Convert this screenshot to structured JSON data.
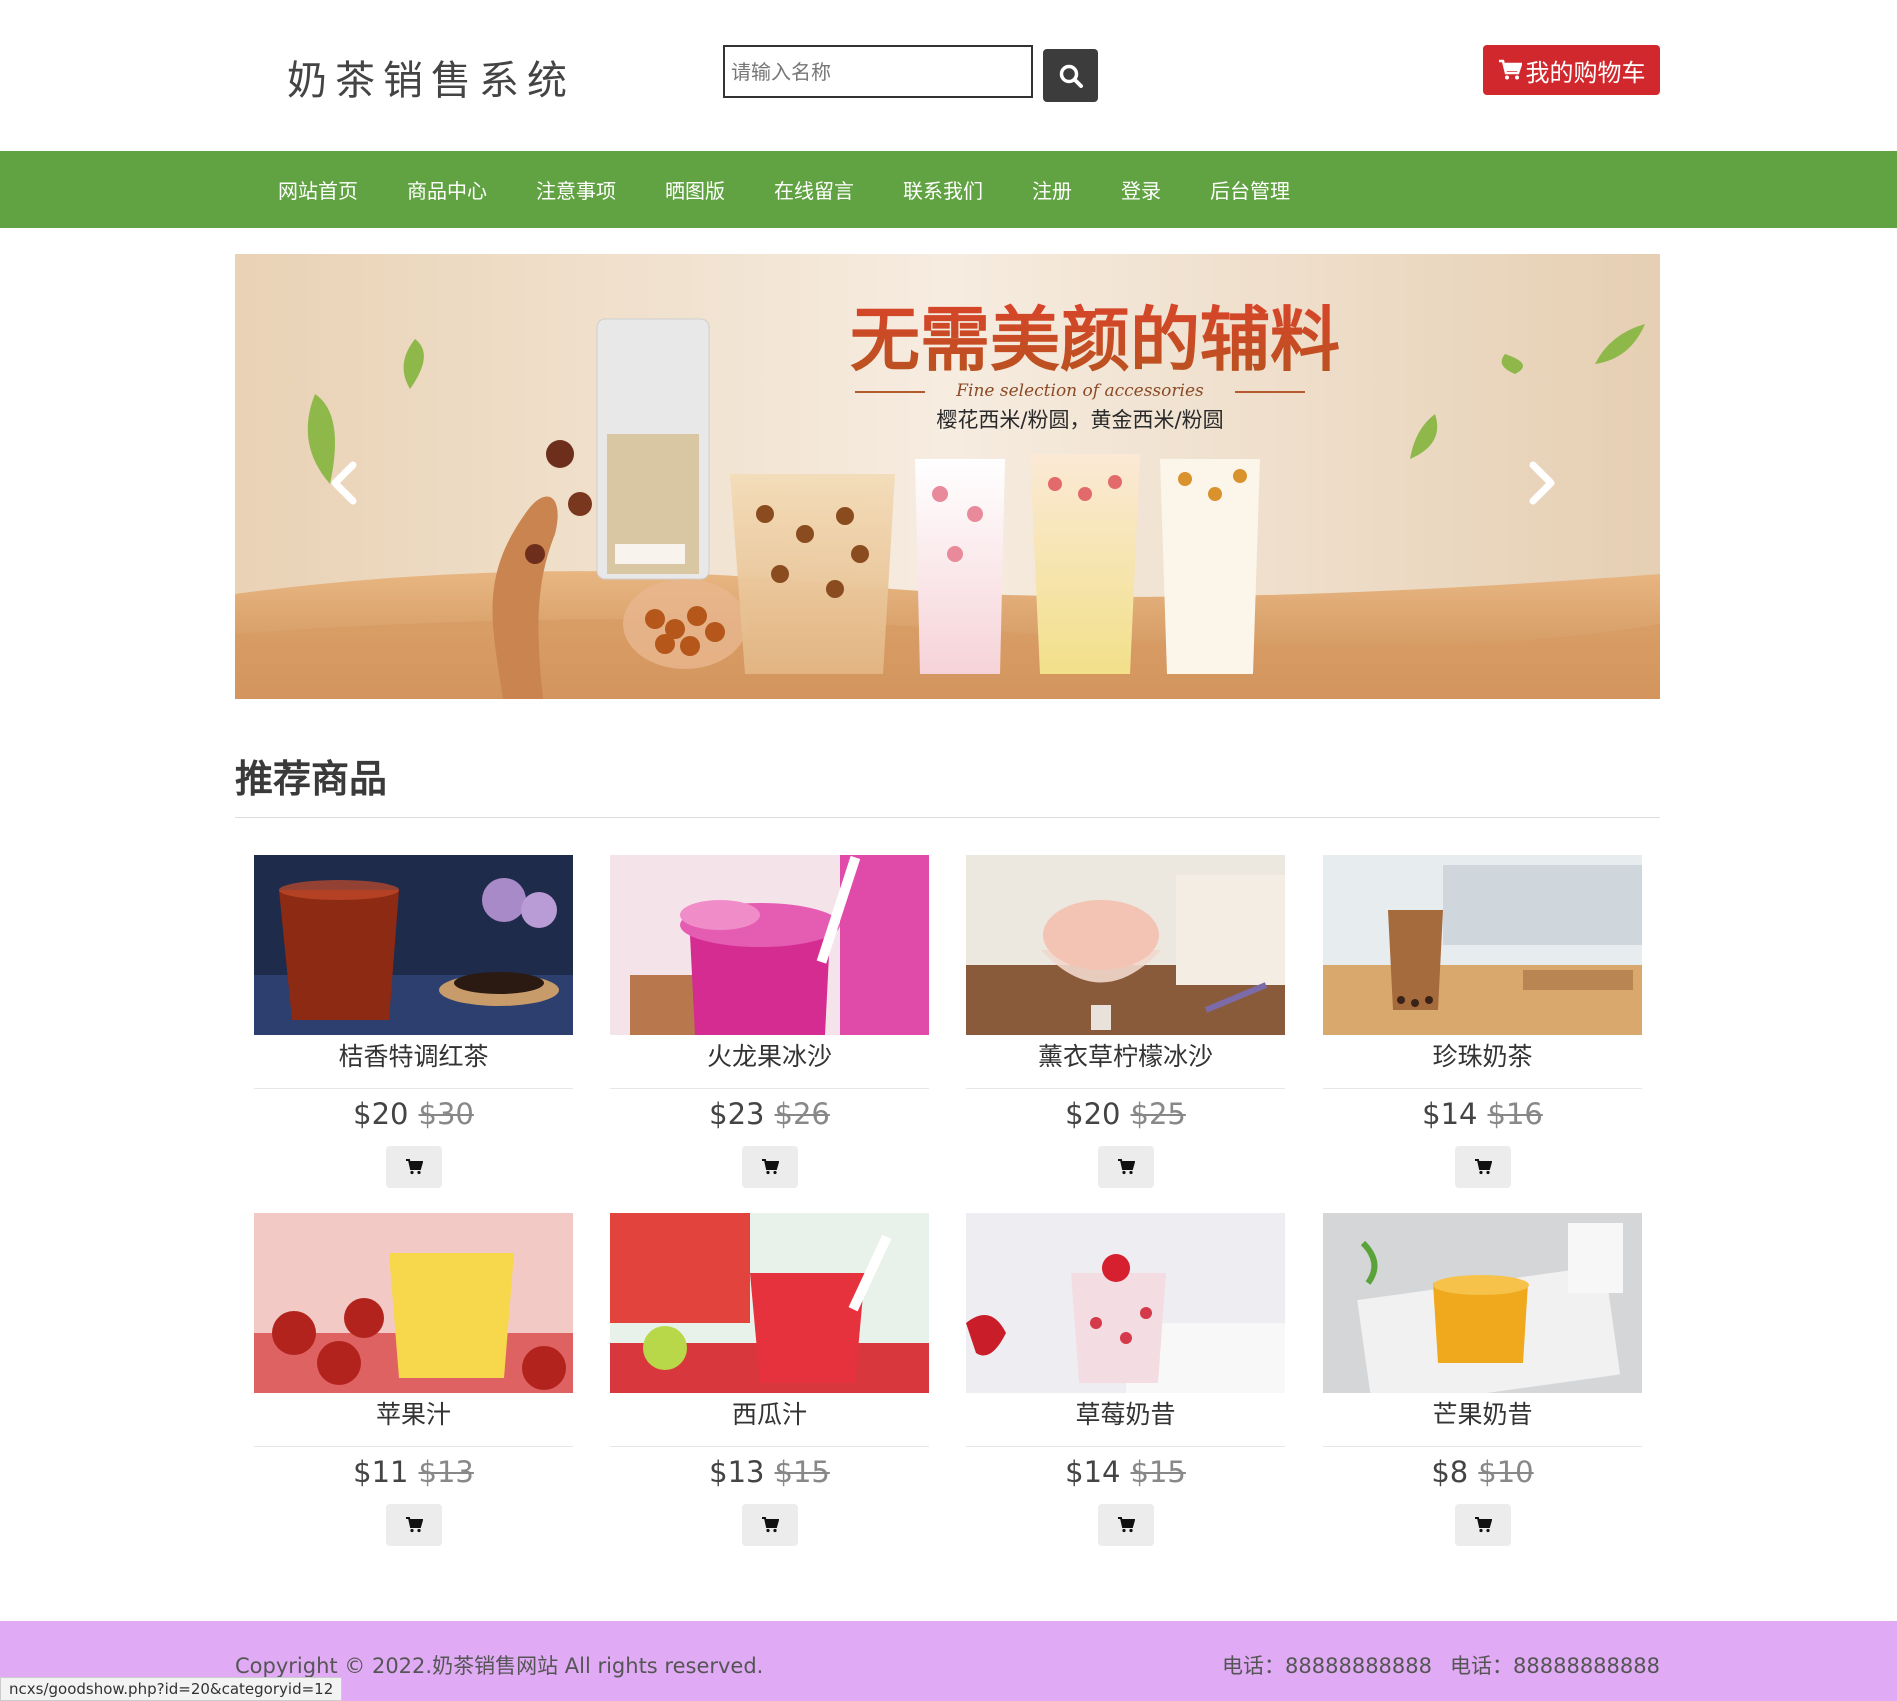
{
  "header": {
    "title": "奶茶销售系统",
    "search_placeholder": "请输入名称",
    "cart_label": "我的购物车"
  },
  "nav": {
    "items": [
      "网站首页",
      "商品中心",
      "注意事项",
      "晒图版",
      "在线留言",
      "联系我们",
      "注册",
      "登录",
      "后台管理"
    ]
  },
  "banner": {
    "headline": "无需美颜的辅料",
    "tagline": "Fine selection of accessories",
    "sub": "樱花西米/粉圆，黄金西米/粉圆"
  },
  "section": {
    "title": "推荐商品"
  },
  "products": [
    {
      "name": "桔香特调红茶",
      "price": "$20",
      "old_price": "$30",
      "image": "red-tea-photo"
    },
    {
      "name": "火龙果冰沙",
      "price": "$23",
      "old_price": "$26",
      "image": "dragonfruit-smoothie-photo"
    },
    {
      "name": "薰衣草柠檬冰沙",
      "price": "$20",
      "old_price": "$25",
      "image": "lavender-lemon-photo"
    },
    {
      "name": "珍珠奶茶",
      "price": "$14",
      "old_price": "$16",
      "image": "bubble-tea-photo"
    },
    {
      "name": "苹果汁",
      "price": "$11",
      "old_price": "$13",
      "image": "apple-juice-photo"
    },
    {
      "name": "西瓜汁",
      "price": "$13",
      "old_price": "$15",
      "image": "watermelon-juice-photo"
    },
    {
      "name": "草莓奶昔",
      "price": "$14",
      "old_price": "$15",
      "image": "strawberry-shake-photo"
    },
    {
      "name": "芒果奶昔",
      "price": "$8",
      "old_price": "$10",
      "image": "mango-shake-photo"
    }
  ],
  "footer": {
    "copyright": "Copyright © 2022.奶茶销售网站 All rights reserved.",
    "phone1": "电话：88888888888",
    "phone2": "电话：88888888888"
  },
  "status_url": "ncxs/goodshow.php?id=20&categoryid=12",
  "colors": {
    "nav_bg": "#61a342",
    "cart_red": "#d0282d",
    "footer_bg": "#e0abf4"
  }
}
